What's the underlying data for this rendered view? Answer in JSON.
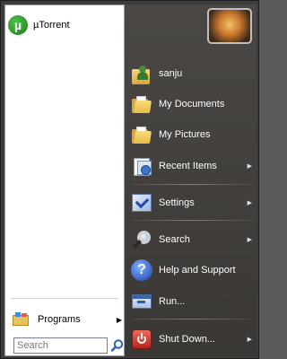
{
  "pinned": [
    {
      "label": "µTorrent",
      "icon": "utorrent-icon"
    }
  ],
  "left": {
    "programs_label": "Programs",
    "search_placeholder": "Search"
  },
  "right": {
    "items": [
      {
        "label": "sanju",
        "icon": "user-folder-icon",
        "has_arrow": false
      },
      {
        "label": "My Documents",
        "icon": "documents-folder-icon",
        "has_arrow": false
      },
      {
        "label": "My Pictures",
        "icon": "pictures-folder-icon",
        "has_arrow": false
      },
      {
        "label": "Recent Items",
        "icon": "recent-items-icon",
        "has_arrow": true
      },
      {
        "label": "Settings",
        "icon": "settings-icon",
        "has_arrow": true
      },
      {
        "label": "Search",
        "icon": "magnifier-icon",
        "has_arrow": true
      },
      {
        "label": "Help and Support",
        "icon": "help-icon",
        "has_arrow": false
      },
      {
        "label": "Run...",
        "icon": "run-icon",
        "has_arrow": false
      },
      {
        "label": "Shut Down...",
        "icon": "power-icon",
        "has_arrow": true
      }
    ]
  },
  "colors": {
    "right_panel": "#3c3a37",
    "left_panel": "#ffffff",
    "shutdown_button": "#d0352a"
  }
}
